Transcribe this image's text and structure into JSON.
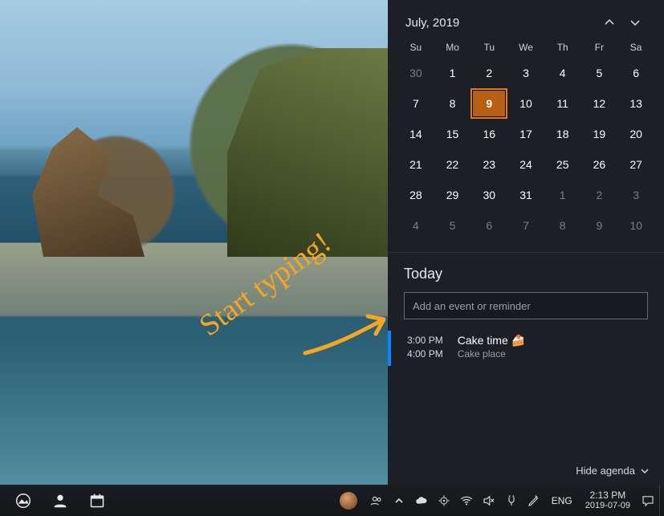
{
  "calendar": {
    "month_label": "July, 2019",
    "dow": [
      "Su",
      "Mo",
      "Tu",
      "We",
      "Th",
      "Fr",
      "Sa"
    ],
    "today_day": 9,
    "grid": [
      [
        {
          "d": 30,
          "dim": true
        },
        {
          "d": 1
        },
        {
          "d": 2
        },
        {
          "d": 3
        },
        {
          "d": 4
        },
        {
          "d": 5
        },
        {
          "d": 6
        }
      ],
      [
        {
          "d": 7
        },
        {
          "d": 8
        },
        {
          "d": 9,
          "today": true
        },
        {
          "d": 10
        },
        {
          "d": 11
        },
        {
          "d": 12
        },
        {
          "d": 13
        }
      ],
      [
        {
          "d": 14
        },
        {
          "d": 15
        },
        {
          "d": 16
        },
        {
          "d": 17
        },
        {
          "d": 18
        },
        {
          "d": 19
        },
        {
          "d": 20
        }
      ],
      [
        {
          "d": 21
        },
        {
          "d": 22
        },
        {
          "d": 23
        },
        {
          "d": 24
        },
        {
          "d": 25
        },
        {
          "d": 26
        },
        {
          "d": 27
        }
      ],
      [
        {
          "d": 28
        },
        {
          "d": 29
        },
        {
          "d": 30
        },
        {
          "d": 31
        },
        {
          "d": 1,
          "dim": true
        },
        {
          "d": 2,
          "dim": true
        },
        {
          "d": 3,
          "dim": true
        }
      ],
      [
        {
          "d": 4,
          "dim": true
        },
        {
          "d": 5,
          "dim": true
        },
        {
          "d": 6,
          "dim": true
        },
        {
          "d": 7,
          "dim": true
        },
        {
          "d": 8,
          "dim": true
        },
        {
          "d": 9,
          "dim": true
        },
        {
          "d": 10,
          "dim": true
        }
      ]
    ]
  },
  "agenda": {
    "heading": "Today",
    "input_placeholder": "Add an event or reminder",
    "hide_label": "Hide agenda",
    "event": {
      "start": "3:00 PM",
      "end": "4:00 PM",
      "title": "Cake time 🍰",
      "place": "Cake place",
      "accent": "#0a84ff"
    }
  },
  "annotation": {
    "text": "Start typing!"
  },
  "taskbar": {
    "lang": "ENG",
    "time": "2:13 PM",
    "date": "2019-07-09"
  }
}
